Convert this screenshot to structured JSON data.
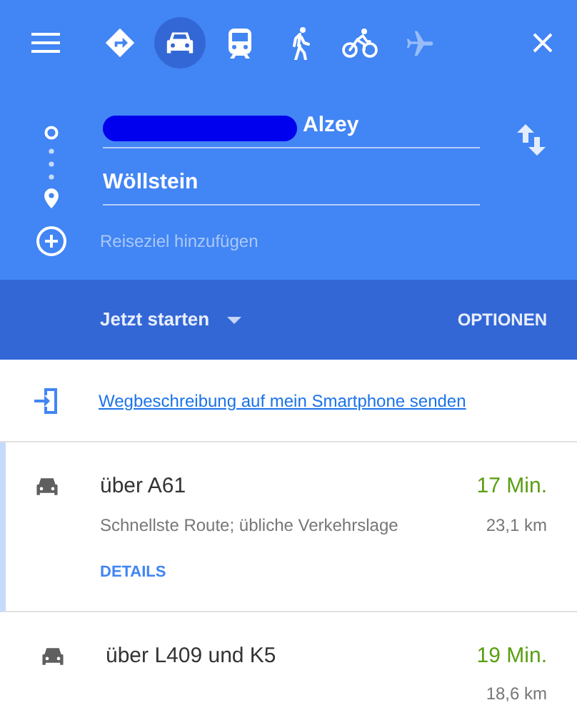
{
  "travel_modes": [
    {
      "kind": "best",
      "selected": false,
      "disabled": false
    },
    {
      "kind": "car",
      "selected": true,
      "disabled": false
    },
    {
      "kind": "transit",
      "selected": false,
      "disabled": false
    },
    {
      "kind": "walk",
      "selected": false,
      "disabled": false
    },
    {
      "kind": "bike",
      "selected": false,
      "disabled": false
    },
    {
      "kind": "flight",
      "selected": false,
      "disabled": true
    }
  ],
  "origin": {
    "value": "Alzey",
    "redacted": true
  },
  "destination": {
    "value": "Wöllstein"
  },
  "add_destination": {
    "placeholder": "Reiseziel hinzufügen"
  },
  "depart": {
    "label": "Jetzt starten"
  },
  "options": {
    "label": "OPTIONEN"
  },
  "send_link": "Wegbeschreibung auf mein Smartphone senden",
  "routes": [
    {
      "name": "über A61",
      "duration": "17 Min.",
      "description": "Schnellste Route; übliche Verkehrslage",
      "distance": "23,1 km",
      "details": "DETAILS",
      "selected": true
    },
    {
      "name": "über L409 und K5",
      "duration": "19 Min.",
      "distance": "18,6 km",
      "selected": false
    }
  ]
}
